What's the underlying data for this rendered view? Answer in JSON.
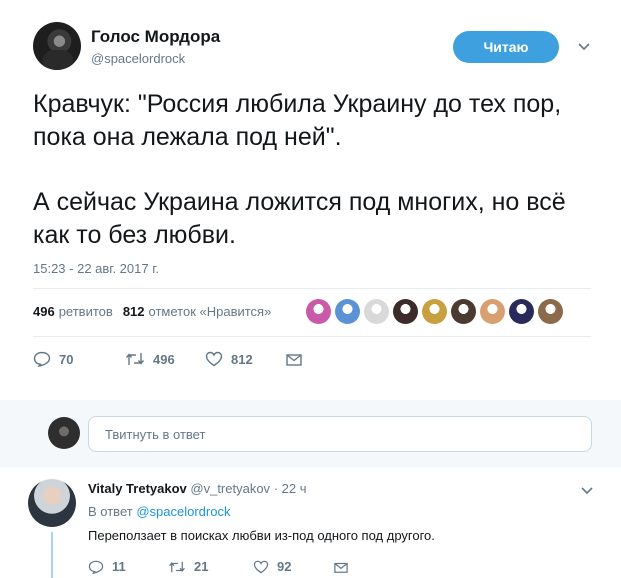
{
  "tweet": {
    "author_name": "Голос Мордора",
    "author_handle": "@spacelordrock",
    "follow_label": "Читаю",
    "text_paragraph_1": "Кравчук: \"Россия любила Украину до тех пор, пока она лежала под ней\".",
    "text_paragraph_2": "А сейчас Украина ложится под многих, но всё как то без любви.",
    "timestamp": "15:23 - 22 авг. 2017 г.",
    "retweets_count": "496",
    "retweets_label": "ретвитов",
    "likes_count": "812",
    "likes_label": "отметок «Нравится»",
    "actions": {
      "replies": "70",
      "retweets": "496",
      "likes": "812"
    },
    "liker_avatar_colors": [
      "#c85aa8",
      "#5b92d6",
      "#d9d9d9",
      "#3d2a2a",
      "#c8a040",
      "#4a3a30",
      "#d8a070",
      "#2a2a5a",
      "#8a6a4a"
    ]
  },
  "reply_box": {
    "placeholder": "Твитнуть в ответ"
  },
  "reply": {
    "author_name": "Vitaly Tretyakov",
    "author_handle": "@v_tretyakov",
    "time": "22 ч",
    "in_reply_prefix": "В ответ",
    "in_reply_handle": "@spacelordrock",
    "text": "Переползает в поисках любви из-под одного под другого.",
    "actions": {
      "replies": "11",
      "retweets": "21",
      "likes": "92"
    }
  },
  "colors": {
    "accent": "#1b95e0",
    "follow_button": "#3fa0e0",
    "muted": "#657786"
  }
}
